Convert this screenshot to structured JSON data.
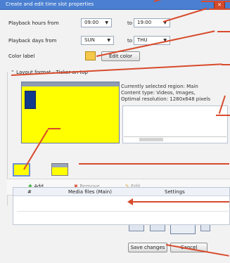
{
  "window": {
    "title": "Create and edit time slot properties"
  },
  "form": {
    "playback_hours_from": "Playback hours from",
    "playback_hours_from_value": "09:00",
    "to": "to",
    "playback_hours_to_value": "19:00",
    "playback_days_from": "Playback days from",
    "playback_days_from_value": "SUN",
    "playback_days_to_value": "THU",
    "color_label": "Color label",
    "edit_color": "Edit color"
  },
  "layout": {
    "title": "Layout format - Ticker on top",
    "info_line1": "Currently selected region: Main",
    "info_line2": "Content type: Videos, Images,",
    "info_line3": "Optimal resolution: 1280x648 pixels"
  },
  "toolbar": {
    "add": "Add",
    "remove": "Remove",
    "edit": "Edit"
  },
  "table": {
    "headers": [
      "#",
      "Media files (Main)",
      "Settings"
    ]
  },
  "footer": {
    "save_changes": "Save changes",
    "cancel": "Cancel"
  },
  "icons": {
    "add": "plus-icon",
    "remove": "x-icon",
    "edit": "pencil-icon",
    "close": "close-icon"
  },
  "colors": {
    "titlebar": "#4a7fd1",
    "accent_red": "#d84b2c",
    "preview": "#ffff00",
    "swatch": "#f6c84a"
  }
}
